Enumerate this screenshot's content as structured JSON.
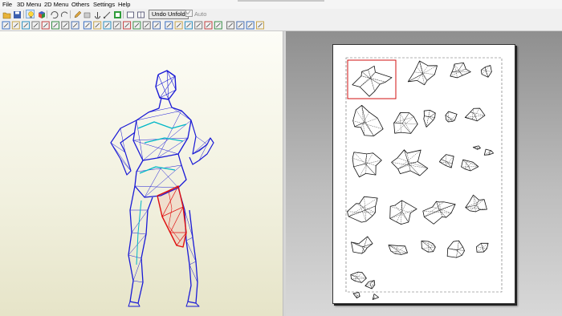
{
  "menu": {
    "items": [
      "File",
      "3D Menu",
      "2D Menu",
      "Others",
      "Settings",
      "Help"
    ]
  },
  "toolbar": {
    "undo_unfold_label": "Undo Unfold",
    "auto_label": "Auto",
    "auto_checked": true
  },
  "colors": {
    "model_edge": "#1a1ad6",
    "model_highlight": "#00b7c7",
    "selected_part": "#e01010",
    "paper": "#ffffff"
  },
  "icons": [
    "open-icon",
    "save-icon",
    "lightbulb-icon",
    "cube-icon",
    "rotate-icon",
    "flip-icon",
    "pencil-icon",
    "box-icon",
    "anchor-icon",
    "edge-icon",
    "chart-icon",
    "rect-icon",
    "grid-icon"
  ]
}
